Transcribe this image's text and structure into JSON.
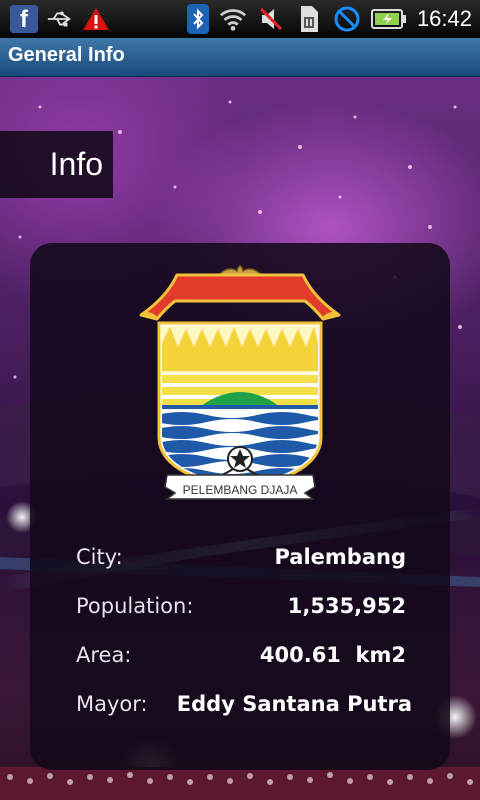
{
  "status_bar": {
    "left_icons": [
      "facebook-icon",
      "usb-icon",
      "warning-icon"
    ],
    "right_icons": [
      "bluetooth-icon",
      "wifi-icon",
      "mute-icon",
      "sim-icon",
      "no-signal-icon",
      "battery-icon"
    ],
    "facebook_glyph": "f",
    "time": "16:42"
  },
  "title_bar": {
    "title": "General Info"
  },
  "header": {
    "label": "Info"
  },
  "emblem": {
    "motto": "PELEMBANG DJAJA"
  },
  "info": {
    "rows": [
      {
        "label": "City:",
        "value": "Palembang"
      },
      {
        "label": "Population:",
        "value": "1,535,952"
      },
      {
        "label": "Area:",
        "value": "400.61  km2"
      },
      {
        "label": "Mayor:",
        "value": "Eddy Santana Putra"
      }
    ]
  },
  "colors": {
    "title_bar": "#2e6595",
    "card_bg": "#120818",
    "roof_red": "#e23a2b",
    "emblem_yellow": "#f5e04a",
    "emblem_blue": "#1f5aa8",
    "emblem_green": "#1fa24a"
  }
}
